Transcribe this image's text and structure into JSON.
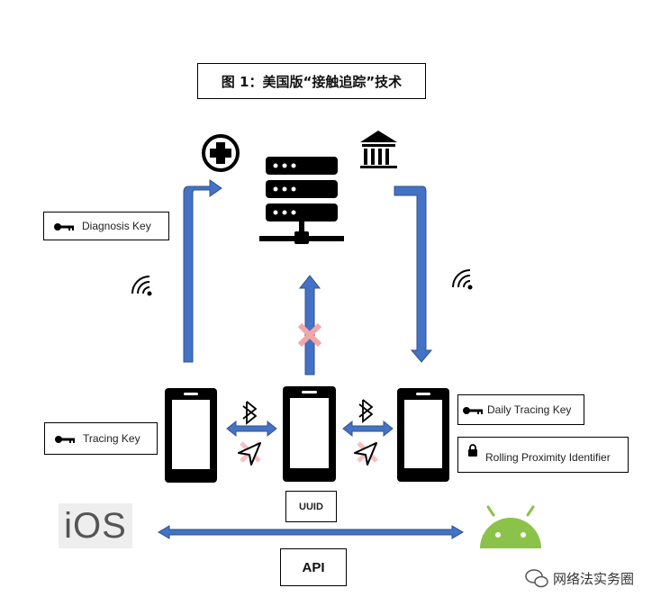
{
  "title": "图 1：美国版“接触追踪”技术",
  "labels": {
    "diagnosis_key": "Diagnosis Key",
    "tracing_key": "Tracing Key",
    "daily_tracing_key": "Daily Tracing Key",
    "rolling_proximity_identifier": "Rolling Proximity Identifier",
    "uuid": "UUID",
    "api": "API"
  },
  "platforms": {
    "ios": "iOS",
    "android": "android-robot-icon"
  },
  "watermark": "网络法实务圈",
  "colors": {
    "arrow_fill": "#4472c4",
    "arrow_stroke": "#2f528f",
    "android_green": "#8bc34a",
    "cross": "#f4a6a6"
  },
  "icons": [
    "medical-cross-icon",
    "server-icon",
    "bank-icon",
    "key-icon",
    "lock-icon",
    "wifi-signal-icon",
    "bluetooth-icon",
    "location-arrow-icon",
    "phone-icon"
  ]
}
